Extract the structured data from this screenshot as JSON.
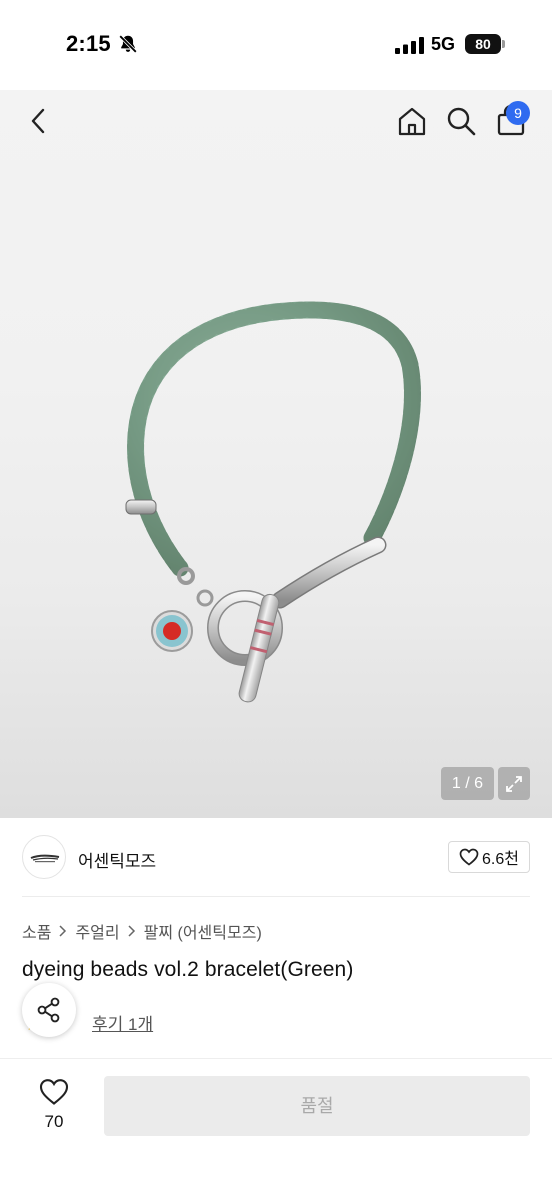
{
  "status_bar": {
    "time": "2:15",
    "network": "5G",
    "battery": "80",
    "icons": [
      "bell-slash-icon",
      "signal-icon",
      "battery-icon"
    ]
  },
  "header": {
    "icons": [
      "back-chevron-icon",
      "home-icon",
      "search-icon",
      "shopping-bag-icon"
    ],
    "cart_count": "9"
  },
  "gallery": {
    "counter": "1 / 6",
    "current": 1,
    "total": 6,
    "expand_icon": "expand-arrows-icon"
  },
  "shop": {
    "name": "어센틱모즈",
    "follow_icon": "heart-outline-icon",
    "follow_count": "6.6천"
  },
  "breadcrumb": [
    "소품",
    "주얼리",
    "팔찌 (어센틱모즈)"
  ],
  "product": {
    "title": "dyeing beads vol.2 bracelet(Green)",
    "review_text": "후기 1개"
  },
  "share": {
    "icon": "share-icon"
  },
  "bottom_bar": {
    "like_icon": "heart-outline-icon",
    "like_count": "70",
    "cta_label": "품절"
  },
  "colors": {
    "accent": "#2f6bf0",
    "soldout_bg": "#ebebeb",
    "soldout_text": "#a9a9a9"
  }
}
